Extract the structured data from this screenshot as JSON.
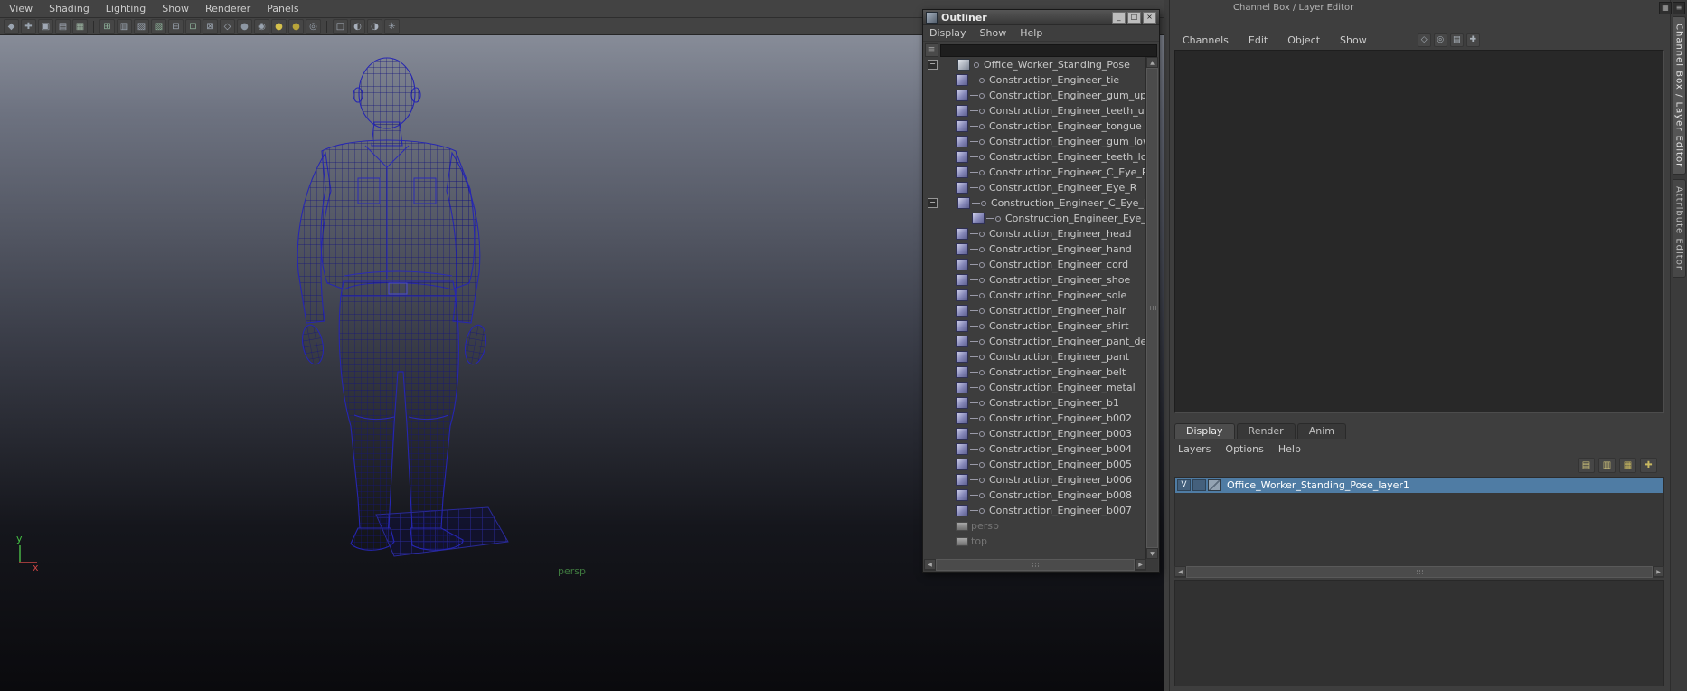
{
  "colors": {
    "ui_gray": "#3e3e3e",
    "selection_blue": "#4f7ca4",
    "wireframe_navy": "#2626b2",
    "persp_green": "#3f7a3f"
  },
  "viewport": {
    "menus": [
      "View",
      "Shading",
      "Lighting",
      "Show",
      "Renderer",
      "Panels"
    ],
    "camera_label": "persp",
    "axis": {
      "up": "y",
      "right": "x"
    },
    "toolbar_icons": [
      {
        "name": "view-cube-icon",
        "glyph": "◆",
        "color": "#9aa4b0"
      },
      {
        "name": "pivot-icon",
        "glyph": "✚",
        "color": "#9aa4b0"
      },
      {
        "name": "camera-lock-icon",
        "glyph": "▣",
        "color": "#a0a8b4"
      },
      {
        "name": "bookmark-icon",
        "glyph": "▤",
        "color": "#a0a8b4"
      },
      {
        "name": "image-plane-icon",
        "glyph": "▦",
        "color": "#9bb3a0"
      },
      {
        "sep": true
      },
      {
        "name": "grid-toggle-icon",
        "glyph": "⊞",
        "color": "#8fb39b"
      },
      {
        "name": "film-gate-icon",
        "glyph": "▥",
        "color": "#9aa4b0"
      },
      {
        "name": "resolution-gate-icon",
        "glyph": "▧",
        "color": "#9aa4b0"
      },
      {
        "name": "gate-mask-icon",
        "glyph": "▨",
        "color": "#8fb39b"
      },
      {
        "name": "field-chart-icon",
        "glyph": "⊟",
        "color": "#9aa4b0"
      },
      {
        "name": "safe-action-icon",
        "glyph": "⊡",
        "color": "#8fb39b"
      },
      {
        "name": "safe-title-icon",
        "glyph": "⊠",
        "color": "#9aa4b0"
      },
      {
        "name": "wireframe-mode-icon",
        "glyph": "◇",
        "color": "#a8b0bc"
      },
      {
        "name": "shaded-mode-icon",
        "glyph": "●",
        "color": "#8e98a4"
      },
      {
        "name": "textured-mode-icon",
        "glyph": "◉",
        "color": "#98a2ae"
      },
      {
        "name": "lighting-icon",
        "glyph": "●",
        "color": "#d4c04c"
      },
      {
        "name": "shadows-icon",
        "glyph": "●",
        "color": "#b8a43a"
      },
      {
        "name": "screen-ao-icon",
        "glyph": "◎",
        "color": "#9aa4b0"
      },
      {
        "sep": true
      },
      {
        "name": "xray-icon",
        "glyph": "□",
        "color": "#a8b0bc"
      },
      {
        "name": "isolate-select-icon",
        "glyph": "◐",
        "color": "#a8b0bc"
      },
      {
        "name": "exposure-icon",
        "glyph": "◑",
        "color": "#a8b0bc"
      },
      {
        "name": "share-view-icon",
        "glyph": "✳",
        "color": "#9aa4b0"
      }
    ]
  },
  "outliner": {
    "title": "Outliner",
    "window_buttons": [
      {
        "name": "minimize-button",
        "glyph": "_"
      },
      {
        "name": "restore-button",
        "glyph": "□"
      },
      {
        "name": "close-button",
        "glyph": "×"
      }
    ],
    "menus": [
      "Display",
      "Show",
      "Help"
    ],
    "search_value": "",
    "items": [
      {
        "label": "Office_Worker_Standing_Pose",
        "type": "root",
        "depth": 0,
        "expander": true
      },
      {
        "label": "Construction_Engineer_tie",
        "type": "mesh",
        "depth": 1
      },
      {
        "label": "Construction_Engineer_gum_upper",
        "type": "mesh",
        "depth": 1
      },
      {
        "label": "Construction_Engineer_teeth_upper",
        "type": "mesh",
        "depth": 1
      },
      {
        "label": "Construction_Engineer_tongue",
        "type": "mesh",
        "depth": 1
      },
      {
        "label": "Construction_Engineer_gum_lower",
        "type": "mesh",
        "depth": 1
      },
      {
        "label": "Construction_Engineer_teeth_lower",
        "type": "mesh",
        "depth": 1
      },
      {
        "label": "Construction_Engineer_C_Eye_R",
        "type": "mesh",
        "depth": 1
      },
      {
        "label": "Construction_Engineer_Eye_R",
        "type": "mesh",
        "depth": 1
      },
      {
        "label": "Construction_Engineer_C_Eye_L",
        "type": "mesh",
        "depth": 1,
        "expander": true
      },
      {
        "label": "Construction_Engineer_Eye_L",
        "type": "mesh",
        "depth": 2
      },
      {
        "label": "Construction_Engineer_head",
        "type": "mesh",
        "depth": 1
      },
      {
        "label": "Construction_Engineer_hand",
        "type": "mesh",
        "depth": 1
      },
      {
        "label": "Construction_Engineer_cord",
        "type": "mesh",
        "depth": 1
      },
      {
        "label": "Construction_Engineer_shoe",
        "type": "mesh",
        "depth": 1
      },
      {
        "label": "Construction_Engineer_sole",
        "type": "mesh",
        "depth": 1
      },
      {
        "label": "Construction_Engineer_hair",
        "type": "mesh",
        "depth": 1
      },
      {
        "label": "Construction_Engineer_shirt",
        "type": "mesh",
        "depth": 1
      },
      {
        "label": "Construction_Engineer_pant_detail",
        "type": "mesh",
        "depth": 1
      },
      {
        "label": "Construction_Engineer_pant",
        "type": "mesh",
        "depth": 1
      },
      {
        "label": "Construction_Engineer_belt",
        "type": "mesh",
        "depth": 1
      },
      {
        "label": "Construction_Engineer_metal",
        "type": "mesh",
        "depth": 1
      },
      {
        "label": "Construction_Engineer_b1",
        "type": "mesh",
        "depth": 1
      },
      {
        "label": "Construction_Engineer_b002",
        "type": "mesh",
        "depth": 1
      },
      {
        "label": "Construction_Engineer_b003",
        "type": "mesh",
        "depth": 1
      },
      {
        "label": "Construction_Engineer_b004",
        "type": "mesh",
        "depth": 1
      },
      {
        "label": "Construction_Engineer_b005",
        "type": "mesh",
        "depth": 1
      },
      {
        "label": "Construction_Engineer_b006",
        "type": "mesh",
        "depth": 1
      },
      {
        "label": "Construction_Engineer_b008",
        "type": "mesh",
        "depth": 1
      },
      {
        "label": "Construction_Engineer_b007",
        "type": "mesh",
        "depth": 1
      },
      {
        "label": "persp",
        "type": "camera",
        "depth": 1,
        "dimmed": true
      },
      {
        "label": "top",
        "type": "camera",
        "depth": 1,
        "dimmed": true
      }
    ]
  },
  "right_panel": {
    "header": "Channel Box / Layer Editor",
    "menus": [
      "Channels",
      "Edit",
      "Object",
      "Show"
    ],
    "header_icons": [
      {
        "name": "speed-state-icon",
        "glyph": "◇"
      },
      {
        "name": "hyperbolic-icon",
        "glyph": "◎"
      },
      {
        "name": "stats-icon",
        "glyph": "▤"
      },
      {
        "name": "options-icon",
        "glyph": "✚"
      }
    ],
    "layer_tabs": [
      "Display",
      "Render",
      "Anim"
    ],
    "active_tab": 0,
    "layer_menus": [
      "Layers",
      "Options",
      "Help"
    ],
    "layer_icons": [
      {
        "name": "move-layer-up-icon",
        "glyph": "▤",
        "color": "#cfc27a"
      },
      {
        "name": "move-layer-down-icon",
        "glyph": "▥",
        "color": "#cfc27a"
      },
      {
        "name": "new-empty-layer-icon",
        "glyph": "▦",
        "color": "#c8b860"
      },
      {
        "name": "new-layer-from-selected-icon",
        "glyph": "✚",
        "color": "#c8b860"
      }
    ],
    "layers": [
      {
        "visibility": "V",
        "playback": "",
        "label": "Office_Worker_Standing_Pose_layer1",
        "selected": true
      }
    ]
  },
  "corner_icons": [
    {
      "name": "panel-layout-icon",
      "glyph": "▦"
    },
    {
      "name": "panel-menu-icon",
      "glyph": "≡"
    }
  ],
  "side_tabs": [
    {
      "label": "Channel Box / Layer Editor",
      "active": true
    },
    {
      "label": "Attribute Editor",
      "active": false
    }
  ]
}
